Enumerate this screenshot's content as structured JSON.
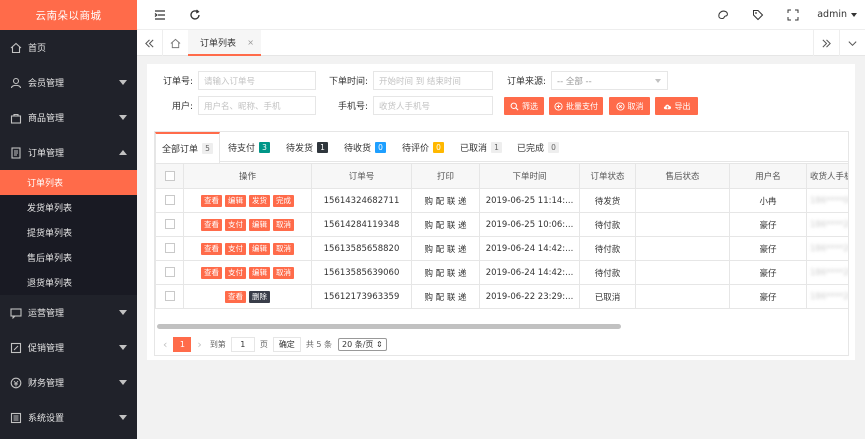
{
  "app": {
    "logo": "云南朵以商城"
  },
  "sidebar": {
    "items": [
      {
        "label": "首页",
        "icon": "home-icon"
      },
      {
        "label": "会员管理",
        "icon": "user-icon"
      },
      {
        "label": "商品管理",
        "icon": "bag-icon"
      },
      {
        "label": "订单管理",
        "icon": "order-icon"
      },
      {
        "label": "运营管理",
        "icon": "chat-icon"
      },
      {
        "label": "促销管理",
        "icon": "promo-icon"
      },
      {
        "label": "财务管理",
        "icon": "finance-icon"
      },
      {
        "label": "系统设置",
        "icon": "settings-icon"
      }
    ],
    "sub_items": [
      "订单列表",
      "发货单列表",
      "提货单列表",
      "售后单列表",
      "退货单列表"
    ]
  },
  "topbar": {
    "user": "admin"
  },
  "tabbar": {
    "active_tab": "订单列表",
    "close": "×"
  },
  "filters": {
    "order_no_label": "订单号:",
    "order_no_placeholder": "请输入订单号",
    "time_label": "下单时间:",
    "time_placeholder": "开始时间 到 结束时间",
    "source_label": "订单来源:",
    "source_value": "-- 全部 --",
    "user_label": "用户:",
    "user_placeholder": "用户名、昵称、手机",
    "phone_label": "手机号:",
    "phone_placeholder": "收货人手机号"
  },
  "buttons": {
    "filter": "筛选",
    "batch_pay": "批量支付",
    "cancel": "取消",
    "export": "导出"
  },
  "order_tabs": [
    {
      "label": "全部订单",
      "count": "5",
      "color": "#eeeeee",
      "text": "#666666"
    },
    {
      "label": "待支付",
      "count": "3",
      "color": "#009688",
      "text": "#ffffff"
    },
    {
      "label": "待发货",
      "count": "1",
      "color": "#2f363c",
      "text": "#ffffff"
    },
    {
      "label": "待收货",
      "count": "0",
      "color": "#1e9fff",
      "text": "#ffffff"
    },
    {
      "label": "待评价",
      "count": "0",
      "color": "#ffb800",
      "text": "#ffffff"
    },
    {
      "label": "已取消",
      "count": "1",
      "color": "#eeeeee",
      "text": "#666666"
    },
    {
      "label": "已完成",
      "count": "0",
      "color": "#eeeeee",
      "text": "#666666"
    }
  ],
  "table": {
    "headers": [
      "操作",
      "订单号",
      "打印",
      "下单时间",
      "订单状态",
      "售后状态",
      "用户名",
      "收货人手机号"
    ],
    "rows": [
      {
        "ops": [
          "查看",
          "编辑",
          "发货",
          "完成"
        ],
        "order_no": "15614324682711",
        "print": "购 配 联 递",
        "time": "2019-06-25 11:14:...",
        "status": "待发货",
        "after": "",
        "user": "小冉",
        "phone": "186****0000"
      },
      {
        "ops": [
          "查看",
          "支付",
          "编辑",
          "取消"
        ],
        "order_no": "15614284119348",
        "print": "购 配 联 递",
        "time": "2019-06-25 10:06:...",
        "status": "待付款",
        "after": "",
        "user": "豪仔",
        "phone": "186****2000"
      },
      {
        "ops": [
          "查看",
          "支付",
          "编辑",
          "取消"
        ],
        "order_no": "15613585658820",
        "print": "购 配 联 递",
        "time": "2019-06-24 14:42:...",
        "status": "待付款",
        "after": "",
        "user": "豪仔",
        "phone": "186****2000"
      },
      {
        "ops": [
          "查看",
          "支付",
          "编辑",
          "取消"
        ],
        "order_no": "15613585639060",
        "print": "购 配 联 递",
        "time": "2019-06-24 14:42:...",
        "status": "待付款",
        "after": "",
        "user": "豪仔",
        "phone": "186****2000"
      },
      {
        "ops": [
          "查看",
          "删除"
        ],
        "order_no": "15612173963359",
        "print": "购 配 联 递",
        "time": "2019-06-22 23:29:...",
        "status": "已取消",
        "after": "",
        "user": "豪仔",
        "phone": "186****2000"
      }
    ]
  },
  "pager": {
    "prev": "‹",
    "page": "1",
    "next": "›",
    "goto": "到第",
    "goto_value": "1",
    "page_unit": "页",
    "confirm": "确定",
    "total": "共 5 条",
    "size": "20 条/页 ⇕"
  }
}
